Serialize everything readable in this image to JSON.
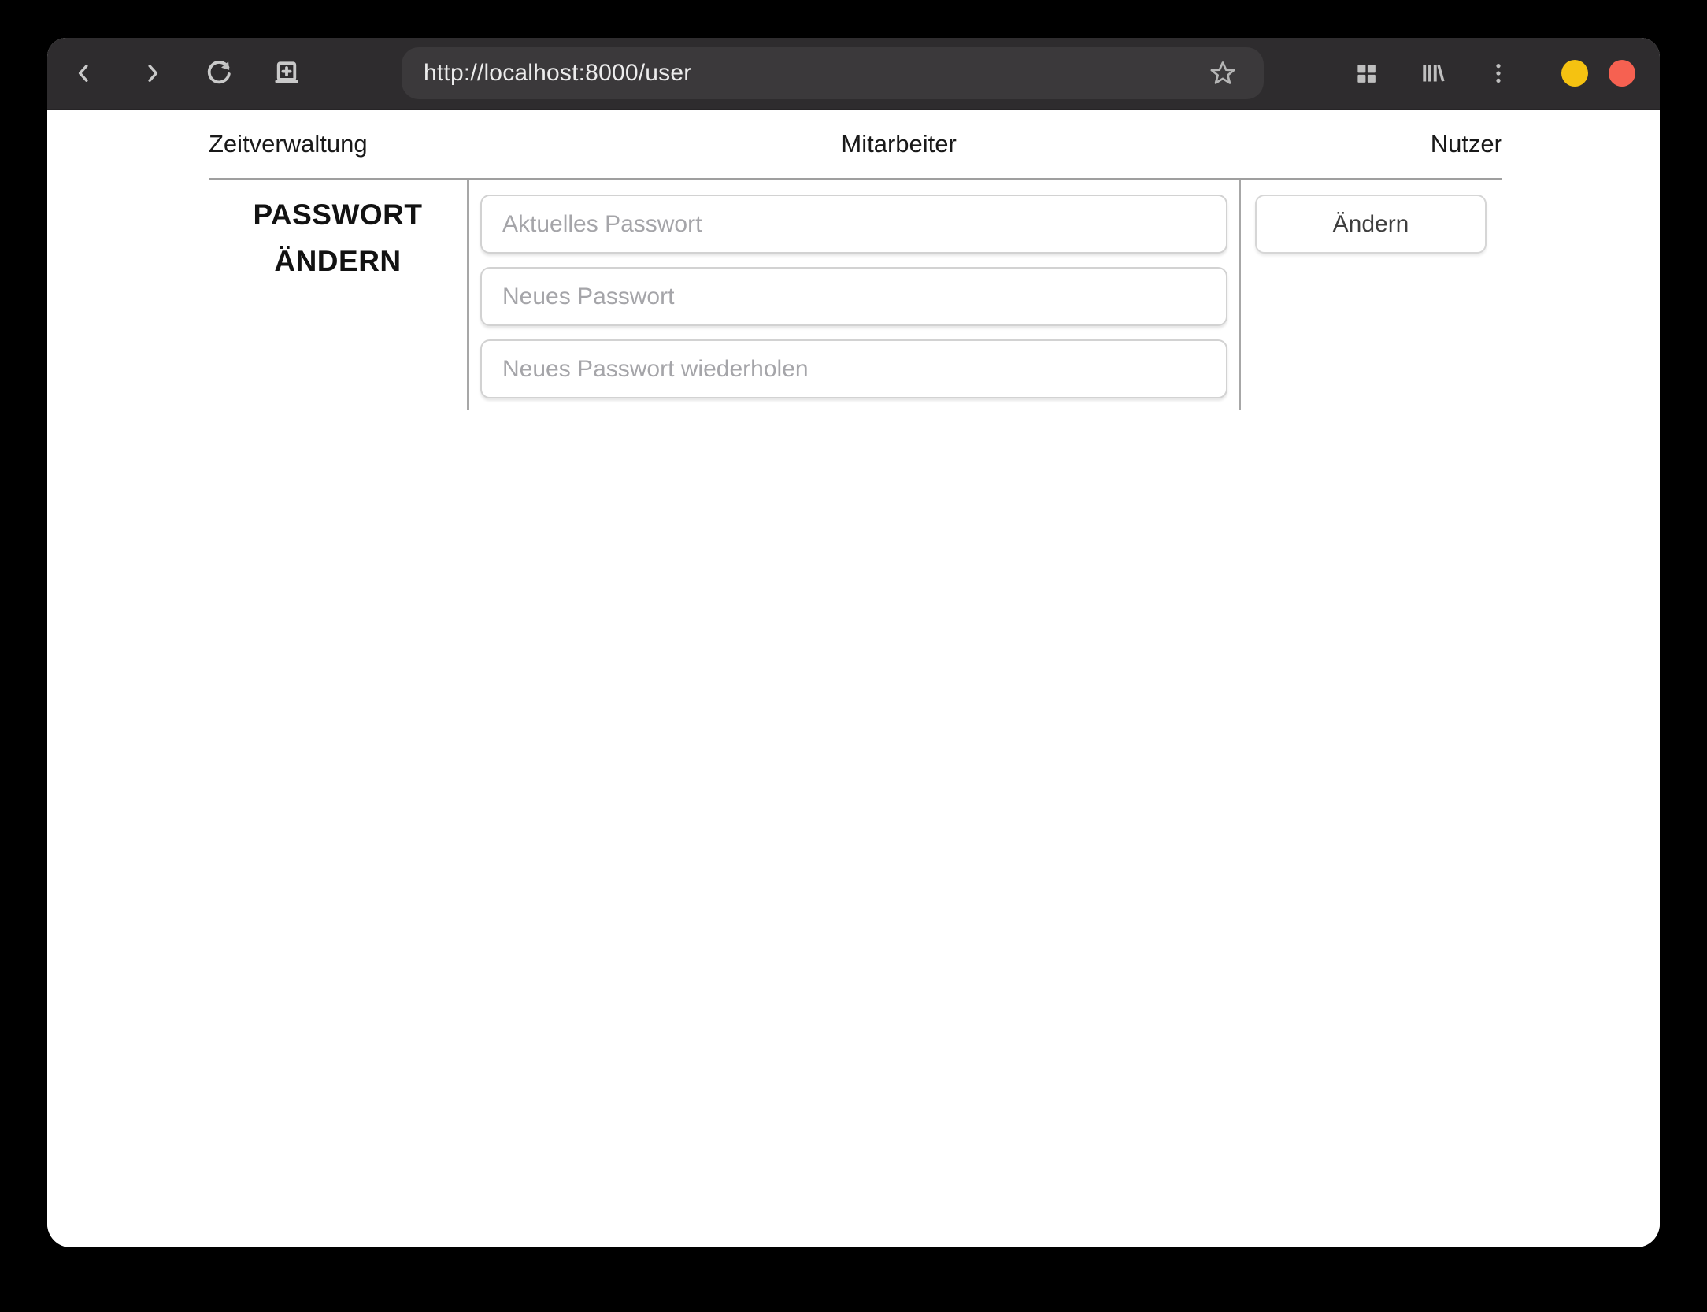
{
  "browser": {
    "url": "http://localhost:8000/user",
    "window_controls": {
      "minimize_color": "#f5c211",
      "close_color": "#f66151"
    }
  },
  "nav": {
    "items": [
      {
        "label": "Zeitverwaltung"
      },
      {
        "label": "Mitarbeiter"
      },
      {
        "label": "Nutzer"
      }
    ]
  },
  "password_section": {
    "heading_line1": "PASSWORT",
    "heading_line2": "ÄNDERN",
    "fields": [
      {
        "placeholder": "Aktuelles Passwort",
        "value": ""
      },
      {
        "placeholder": "Neues Passwort",
        "value": ""
      },
      {
        "placeholder": "Neues Passwort wiederholen",
        "value": ""
      }
    ],
    "submit_label": "Ändern"
  }
}
